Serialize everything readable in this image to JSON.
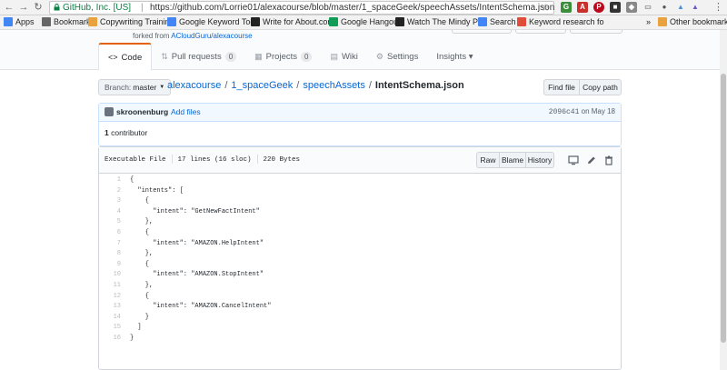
{
  "browser": {
    "secure_label": "GitHub, Inc. [US]",
    "url": "https://github.com/Lorrie01/alexacourse/blob/master/1_spaceGeek/speechAssets/IntentSchema.json",
    "bookmarks": [
      {
        "label": "Apps",
        "icon": "apps-grid-icon",
        "color": "#4285f4"
      },
      {
        "label": "Bookmarks",
        "icon": "star-icon",
        "color": "#666666"
      },
      {
        "label": "Copywriting Training",
        "icon": "folder-icon",
        "color": "#e8a33d"
      },
      {
        "label": "Google Keyword Tool",
        "icon": "g-icon",
        "color": "#4285f4"
      },
      {
        "label": "Write for About.com",
        "icon": "d-icon",
        "color": "#222222"
      },
      {
        "label": "Google Hangouts",
        "icon": "hangouts-icon",
        "color": "#0f9d58"
      },
      {
        "label": "Watch The Mindy Pro",
        "icon": "h-icon",
        "color": "#222222"
      },
      {
        "label": "Search",
        "icon": "g-icon",
        "color": "#4285f4"
      },
      {
        "label": "Keyword research fo",
        "icon": "arrow-icon",
        "color": "#e04e39"
      },
      {
        "label": "Other bookmarks",
        "icon": "folder-icon",
        "color": "#e8a33d"
      }
    ],
    "overflow": "»"
  },
  "repo": {
    "forked_prefix": "forked from",
    "forked_link": "ACloudGuru/alexacourse",
    "tabs": [
      {
        "icon": "code-icon",
        "label": "Code",
        "active": true,
        "count": null
      },
      {
        "icon": "pull-request-icon",
        "label": "Pull requests",
        "active": false,
        "count": "0"
      },
      {
        "icon": "projects-icon",
        "label": "Projects",
        "active": false,
        "count": "0"
      },
      {
        "icon": "wiki-icon",
        "label": "Wiki",
        "active": false,
        "count": null
      },
      {
        "icon": "gear-icon",
        "label": "Settings",
        "active": false,
        "count": null
      },
      {
        "icon": "",
        "label": "Insights ▾",
        "active": false,
        "count": null
      }
    ]
  },
  "breadcrumb": {
    "branch_prefix": "Branch:",
    "branch": "master",
    "parts": [
      "alexacourse",
      "1_spaceGeek",
      "speechAssets"
    ],
    "file": "IntentSchema.json",
    "sep": "/",
    "find_file": "Find file",
    "copy_path": "Copy path"
  },
  "commit": {
    "author": "skroonenburg",
    "message": "Add files",
    "sha": "2096c41",
    "date": "on May 18",
    "contributors_count": "1",
    "contributors_label": "contributor"
  },
  "file": {
    "mode": "Executable File",
    "lines": "17 lines (16 sloc)",
    "size": "220 Bytes",
    "raw": "Raw",
    "blame": "Blame",
    "history": "History",
    "code": [
      "{",
      "  \"intents\": [",
      "    {",
      "      \"intent\": \"GetNewFactIntent\"",
      "    },",
      "    {",
      "      \"intent\": \"AMAZON.HelpIntent\"",
      "    },",
      "    {",
      "      \"intent\": \"AMAZON.StopIntent\"",
      "    },",
      "    {",
      "      \"intent\": \"AMAZON.CancelIntent\"",
      "    }",
      "  ]",
      "}"
    ],
    "line_numbers": [
      "1",
      "2",
      "3",
      "4",
      "5",
      "6",
      "7",
      "8",
      "9",
      "10",
      "11",
      "12",
      "13",
      "14",
      "15",
      "16"
    ]
  }
}
